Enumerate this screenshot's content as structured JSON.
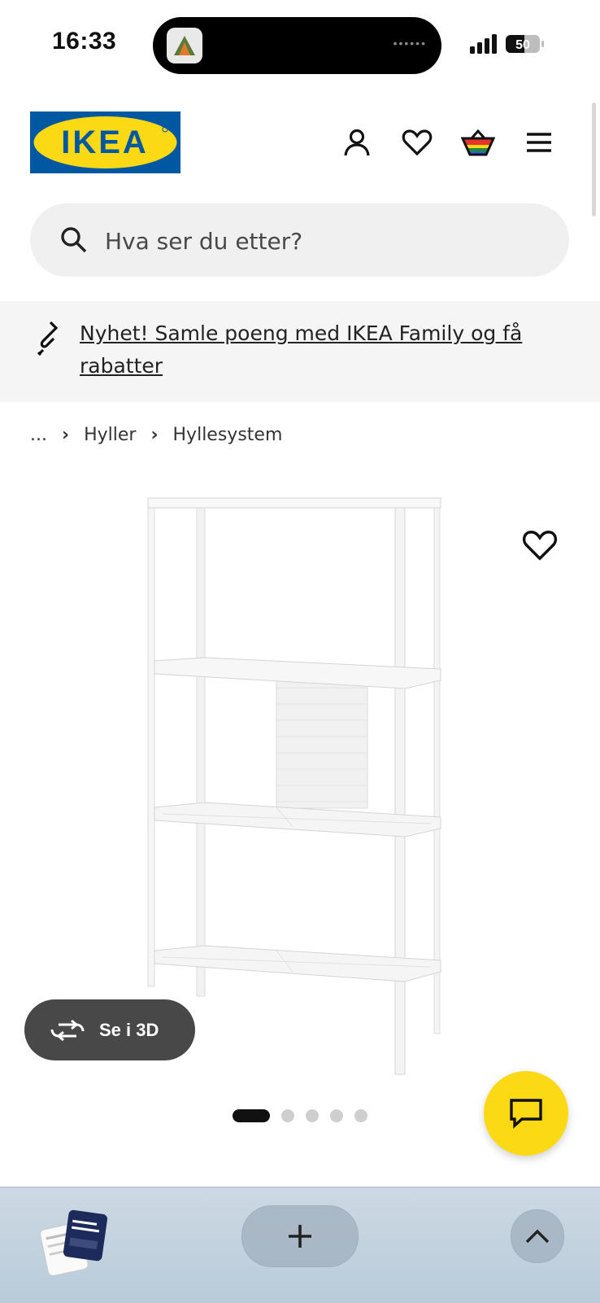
{
  "status": {
    "time": "16:33",
    "battery": "50"
  },
  "header": {
    "logo_text": "IKEA",
    "brand_colors": {
      "blue": "#0058a3",
      "yellow": "#fbd914"
    },
    "icons": [
      "account-icon",
      "heart-icon",
      "basket-icon",
      "menu-icon"
    ]
  },
  "search": {
    "placeholder": "Hva ser du etter?"
  },
  "banner": {
    "text": "Nyhet! Samle poeng med IKEA Family og få rabatter"
  },
  "breadcrumb": {
    "items": [
      "...",
      "Hyller",
      "Hyllesystem"
    ]
  },
  "product": {
    "see_3d_label": "Se i 3D",
    "image_count": 5,
    "active_image": 1
  },
  "colors": {
    "chat_button": "#fbd914",
    "dark_button": "#484848"
  }
}
